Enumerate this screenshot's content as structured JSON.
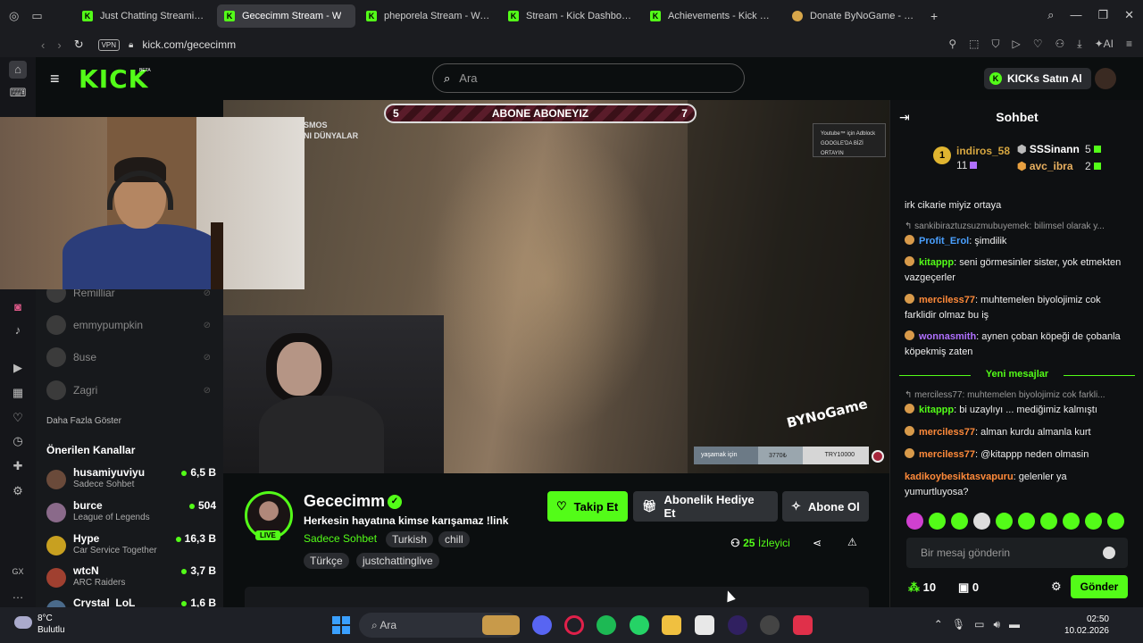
{
  "browser": {
    "tabs": [
      {
        "label": "Just Chatting Streaming -",
        "active": false,
        "favicon": "kick"
      },
      {
        "label": "Gececimm Stream - W",
        "active": true,
        "favicon": "kick"
      },
      {
        "label": "pheporela Stream - Watch",
        "active": false,
        "favicon": "kick"
      },
      {
        "label": "Stream - Kick Dashboard",
        "active": false,
        "favicon": "kick"
      },
      {
        "label": "Achievements - Kick Dash",
        "active": false,
        "favicon": "kick"
      },
      {
        "label": "Donate ByNoGame - Gele",
        "active": false,
        "favicon": "donate"
      }
    ],
    "vpn_label": "VPN",
    "url": "kick.com/gececimm",
    "ai_label": "AI"
  },
  "header": {
    "logo": "KICK",
    "beta": "BETA",
    "search_placeholder": "Ara",
    "kicks_button": "KICKs Satın Al"
  },
  "sidebar": {
    "following": [
      {
        "name": "Remilliar"
      },
      {
        "name": "emmypumpkin"
      },
      {
        "name": "8use"
      },
      {
        "name": "Zagri"
      }
    ],
    "show_more": "Daha Fazla Göster",
    "recommended_title": "Önerilen Kanallar",
    "recommended": [
      {
        "name": "husamiyuviyu",
        "category": "Sadece Sohbet",
        "viewers": "6,5 B",
        "color": "#6a4a3a"
      },
      {
        "name": "burce",
        "category": "League of Legends",
        "viewers": "504",
        "color": "#8a6a8a"
      },
      {
        "name": "Hype",
        "category": "Car Service Together",
        "viewers": "16,3 B",
        "color": "#c8a020"
      },
      {
        "name": "wtcN",
        "category": "ARC Raiders",
        "viewers": "3,7 B",
        "color": "#a04030"
      },
      {
        "name": "Crystal_LoL",
        "category": "",
        "viewers": "1,6 B",
        "color": "#4a6a8a"
      }
    ]
  },
  "video": {
    "overlay_text_line1": "SMOS",
    "overlay_text_line2": "NI DÜNYALAR",
    "sub_goal": {
      "left": "5",
      "label": "ABONE ABONEYIZ",
      "right": "7"
    },
    "adblock_line1": "Youtube™ için Adblock",
    "adblock_line2": "GOOGLE'DA BİZİ ORTAYIN",
    "watermark": "BYNoGame",
    "donation_goal": {
      "label": "yaşamak için",
      "current": "3770₺",
      "target": "TRY10000"
    }
  },
  "channel": {
    "name": "Gececimm",
    "live_label": "LIVE",
    "title": "Herkesin hayatına kimse karışamaz !link",
    "category": "Sadece Sohbet",
    "tags": [
      "Turkish",
      "chill",
      "Türkçe",
      "justchattinglive"
    ],
    "follow_button": "Takip Et",
    "gift_button": "Abonelik Hediye Et",
    "subscribe_button": "Abone Ol",
    "viewer_count": "25",
    "viewer_label": "İzleyici"
  },
  "chat": {
    "title": "Sohbet",
    "leaderboard": [
      {
        "rank": "1",
        "name": "indiros_58",
        "count": "11",
        "color": "#d6a640"
      },
      {
        "name": "SSSinann",
        "count": "5",
        "color": "#ffffff"
      },
      {
        "name": "avc_ibra",
        "count": "2",
        "color": "#e8b060"
      }
    ],
    "messages": [
      {
        "type": "text",
        "text": "irk cikarie miyiz ortaya"
      },
      {
        "type": "reply",
        "text": "sankibiraztuzsuzmubuyemek: bilimsel olarak y..."
      },
      {
        "type": "msg",
        "user": "Profit_Erol",
        "color": "#4aa0ff",
        "text": ": şimdilik"
      },
      {
        "type": "msg",
        "user": "kitappp",
        "color": "#53fc18",
        "text": ": seni görmesinler sister, yok etmekten vazgeçerler"
      },
      {
        "type": "msg",
        "user": "merciless77",
        "color": "#ff8a3a",
        "text": ": muhtemelen biyolojimiz cok farklidir olmaz bu iş"
      },
      {
        "type": "msg",
        "user": "wonnasmith",
        "color": "#b070ff",
        "text": ": aynen çoban köpeği de çobanla köpekmiş zaten"
      },
      {
        "type": "reply",
        "text": "merciless77: muhtemelen biyolojimiz cok farkli..."
      },
      {
        "type": "msg",
        "user": "kitappp",
        "color": "#53fc18",
        "text": ": bi uzaylıyı ... mediğimiz kalmıştı"
      },
      {
        "type": "msg",
        "user": "merciless77",
        "color": "#ff8a3a",
        "text": ": alman kurdu almanla kurt"
      },
      {
        "type": "msg",
        "user": "merciless77",
        "color": "#ff8a3a",
        "text": ": @kitappp neden olmasin"
      },
      {
        "type": "msg",
        "user": "kadikoybesiktasvapuru",
        "color": "#ff8a3a",
        "text": ": gelenler ya yumurtluyosa?"
      }
    ],
    "new_messages": "Yeni mesajlar",
    "input_placeholder": "Bir mesaj gönderin",
    "points": "10",
    "drops": "0",
    "send_button": "Gönder"
  },
  "taskbar": {
    "temperature": "8°C",
    "weather": "Bulutlu",
    "search_label": "Ara",
    "time": "02:50",
    "date": "10.02.2026"
  }
}
